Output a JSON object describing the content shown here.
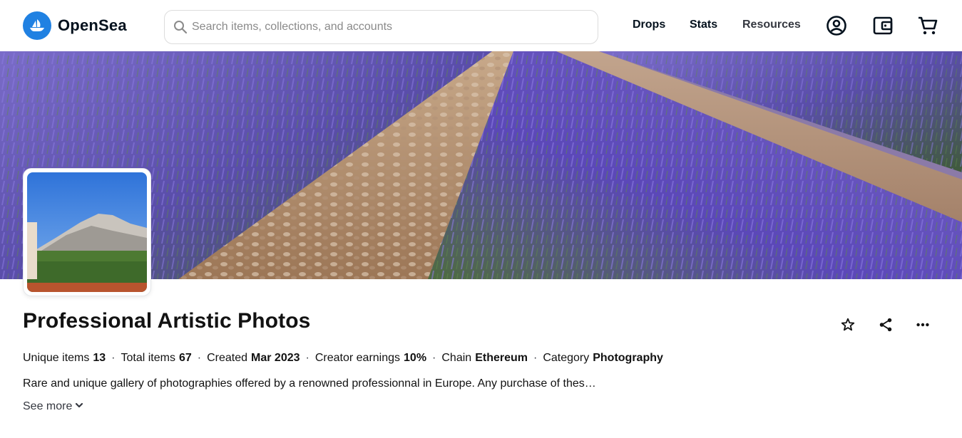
{
  "header": {
    "logo_text": "OpenSea",
    "search_placeholder": "Search items, collections, and accounts",
    "nav": [
      "Drops",
      "Stats",
      "Resources"
    ],
    "icons": [
      "account-icon",
      "wallet-icon",
      "cart-icon"
    ]
  },
  "collection": {
    "title": "Professional Artistic Photos",
    "stats": [
      {
        "label": "Unique items",
        "value": "13"
      },
      {
        "label": "Total items",
        "value": "67"
      },
      {
        "label": "Created",
        "value": "Mar 2023"
      },
      {
        "label": "Creator earnings",
        "value": "10%"
      },
      {
        "label": "Chain",
        "value": "Ethereum"
      },
      {
        "label": "Category",
        "value": "Photography"
      }
    ],
    "separator": "·",
    "description": "Rare and unique gallery of photographies offered by a renowned professionnal in Europe. Any purchase of thes…",
    "see_more": "See more"
  },
  "colors": {
    "brand": "#2081e2",
    "lavender": "#6a52c4",
    "soil": "#a07c5c"
  }
}
